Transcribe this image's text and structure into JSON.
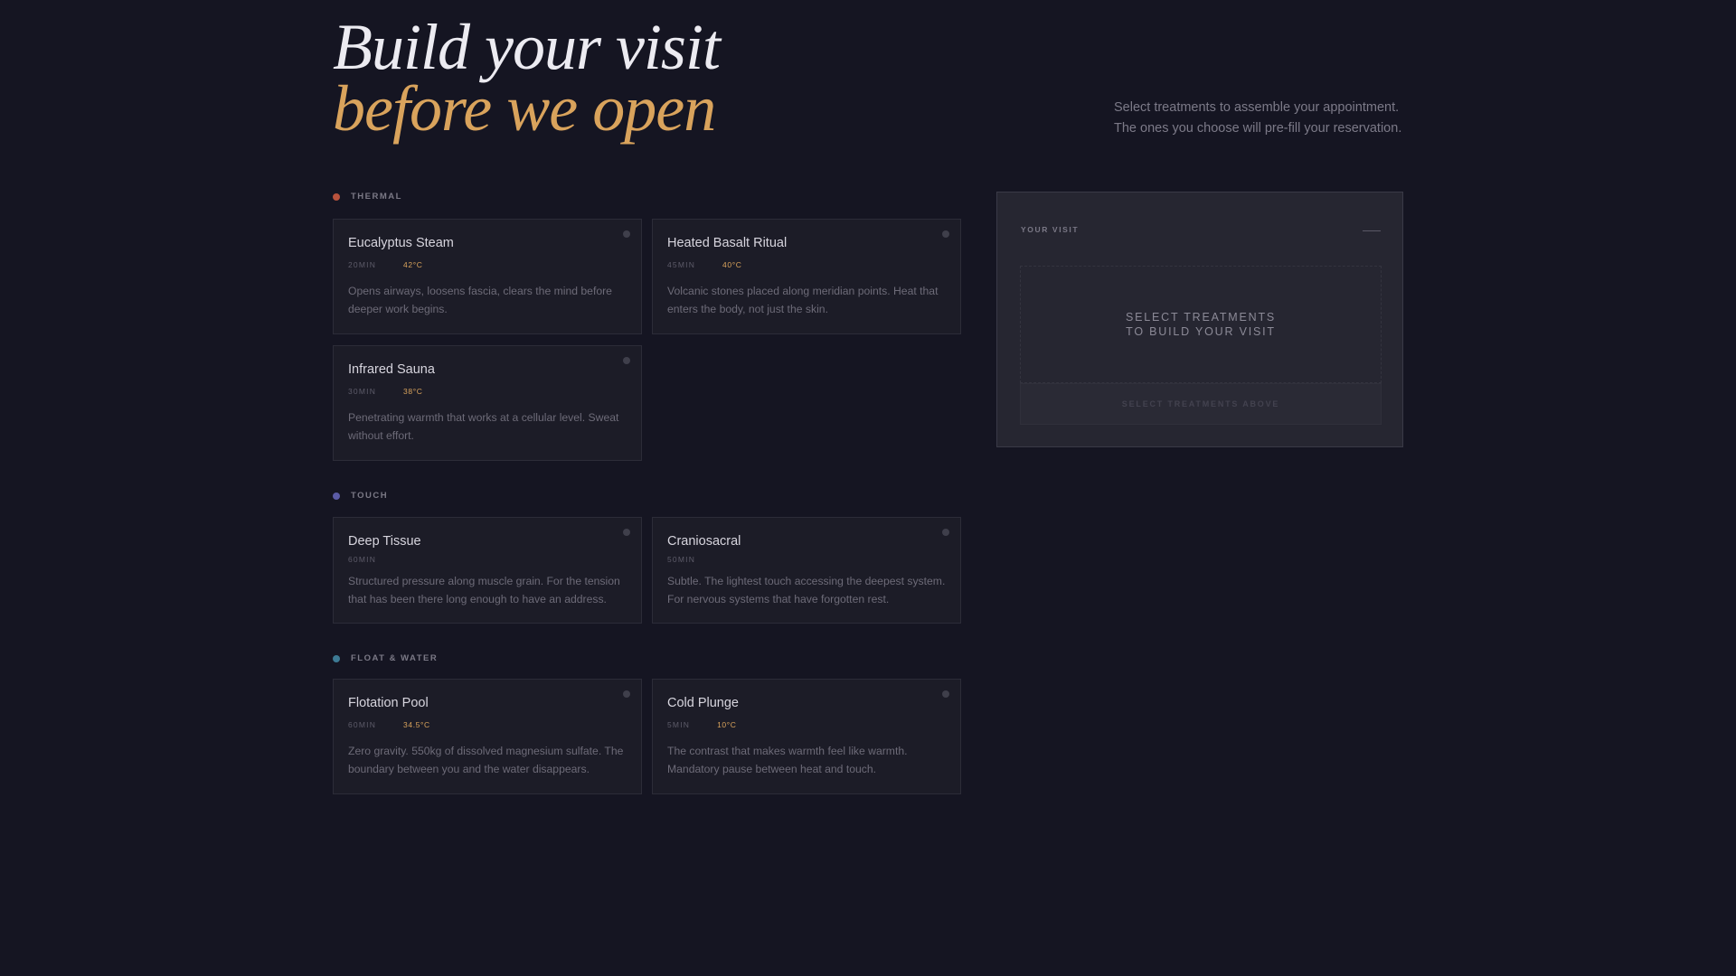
{
  "hero": {
    "title_line1": "Build your visit",
    "title_line2": "before we open",
    "subtitle_line1": "Select treatments to assemble your appointment.",
    "subtitle_line2": "The ones you choose will pre-fill your reservation."
  },
  "colors": {
    "accent": "#d9a35c",
    "thermal": "#b8523d",
    "touch": "#5b5ba6",
    "float_water": "#3d7a94"
  },
  "sections": {
    "thermal": {
      "label": "THERMAL",
      "cards": [
        {
          "title": "Eucalyptus Steam",
          "duration": "20MIN",
          "temp": "42°C",
          "desc": "Opens airways, loosens fascia, clears the mind before deeper work begins."
        },
        {
          "title": "Heated Basalt Ritual",
          "duration": "45MIN",
          "temp": "40°C",
          "desc": "Volcanic stones placed along meridian points. Heat that enters the body, not just the skin."
        },
        {
          "title": "Infrared Sauna",
          "duration": "30MIN",
          "temp": "38°C",
          "desc": "Penetrating warmth that works at a cellular level. Sweat without effort."
        }
      ]
    },
    "touch": {
      "label": "TOUCH",
      "cards": [
        {
          "title": "Deep Tissue",
          "duration": "60MIN",
          "desc": "Structured pressure along muscle grain. For the tension that has been there long enough to have an address."
        },
        {
          "title": "Craniosacral",
          "duration": "50MIN",
          "desc": "Subtle. The lightest touch accessing the deepest system. For nervous systems that have forgotten rest."
        }
      ]
    },
    "float": {
      "label": "FLOAT & WATER",
      "cards": [
        {
          "title": "Flotation Pool",
          "duration": "60MIN",
          "temp": "34.5°C",
          "desc": "Zero gravity. 550kg of dissolved magnesium sulfate. The boundary between you and the water disappears."
        },
        {
          "title": "Cold Plunge",
          "duration": "5MIN",
          "temp": "10°C",
          "desc": "The contrast that makes warmth feel like warmth. Mandatory pause between heat and touch."
        }
      ]
    }
  },
  "visit": {
    "label": "YOUR VISIT",
    "empty_line1": "SELECT TREATMENTS",
    "empty_line2": "TO BUILD YOUR VISIT",
    "cta_label": "SELECT TREATMENTS ABOVE",
    "collapse_icon": "minus-icon"
  }
}
